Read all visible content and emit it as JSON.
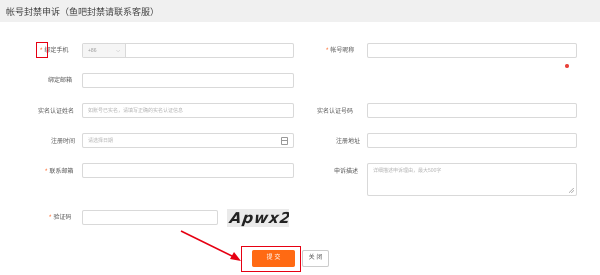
{
  "page": {
    "title": "帐号封禁申诉（鱼吧封禁请联系客服）"
  },
  "form": {
    "bind_phone": {
      "label": "绑定手机",
      "required": true,
      "country_code": "+86",
      "value": ""
    },
    "bind_email": {
      "label": "绑定邮箱",
      "value": ""
    },
    "real_name": {
      "label": "实名认证姓名",
      "placeholder": "如账号已实名，请填写正确的实名认证信息"
    },
    "reg_time": {
      "label": "注册时间",
      "placeholder": "请选择日期"
    },
    "contact_email": {
      "label": "联系邮箱",
      "required": true,
      "value": ""
    },
    "captcha": {
      "label": "验证码",
      "required": true,
      "image_text": "Apwx2"
    },
    "nickname": {
      "label": "帐号昵称",
      "required": true,
      "value": ""
    },
    "real_id": {
      "label": "实名认证号码",
      "value": ""
    },
    "reg_address": {
      "label": "注册地址",
      "value": ""
    },
    "appeal_desc": {
      "label": "申诉描述",
      "placeholder": "详细描述申诉理由，最大500字"
    }
  },
  "actions": {
    "submit_label": "提 交",
    "close_label": "关 闭"
  },
  "colors": {
    "accent": "#ff6a13",
    "required_star": "#ff5e1a",
    "highlight": "#e60012",
    "error_dot": "#e8413a"
  }
}
